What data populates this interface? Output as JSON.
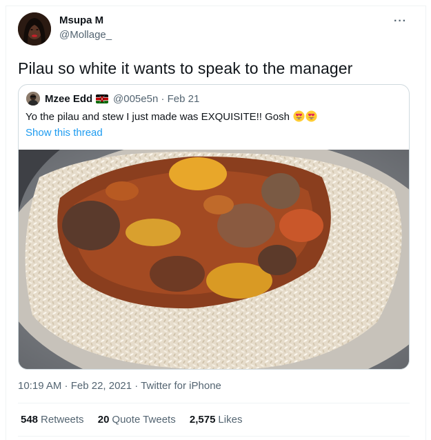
{
  "tweet": {
    "author_name": "Msupa M",
    "author_handle": "@Mollage_",
    "more_icon": "ellipsis-icon",
    "text": "Pilau so white it wants to speak to the manager"
  },
  "quoted": {
    "author_name": "Mzee Edd",
    "flag": "kenya-flag-icon",
    "handle_date": "@005e5n · Feb 21",
    "text": "Yo the pilau and stew I just made was EXQUISITE!! Gosh",
    "emojis": [
      "heart-eyes-emoji",
      "heart-eyes-emoji"
    ],
    "show_thread": "Show this thread",
    "photo": "photo of rice with beef stew"
  },
  "meta": {
    "time": "10:19 AM · Feb 22, 2021 · ",
    "source": "Twitter for iPhone"
  },
  "stats": {
    "retweets_count": "548",
    "retweets_label": "Retweets",
    "quotes_count": "20",
    "quotes_label": "Quote Tweets",
    "likes_count": "2,575",
    "likes_label": "Likes"
  },
  "colors": {
    "text": "#0f1419",
    "secondary": "#536471",
    "link": "#1d9bf0",
    "border": "#cfd9de"
  }
}
